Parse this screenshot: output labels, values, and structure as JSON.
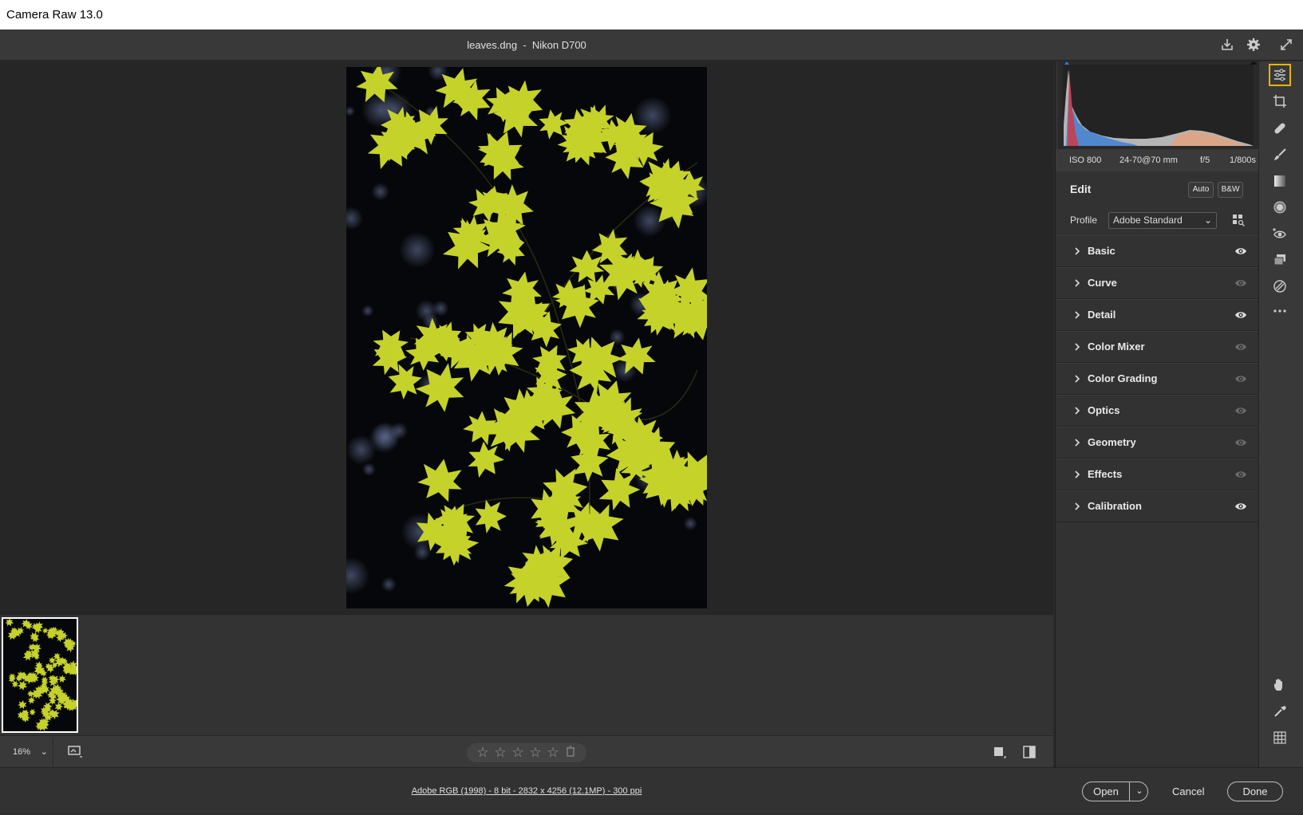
{
  "window": {
    "title": "Camera Raw 13.0"
  },
  "header": {
    "filename": "leaves.dng  -  Nikon D700",
    "icons": [
      "save-icon",
      "gear-icon",
      "fullscreen-icon"
    ]
  },
  "exif": {
    "iso": "ISO 800",
    "lens": "24-70@70 mm",
    "aperture": "f/5",
    "shutter": "1/800s"
  },
  "edit": {
    "title": "Edit",
    "auto_label": "Auto",
    "bw_label": "B&W",
    "profile_label": "Profile",
    "profile_value": "Adobe Standard"
  },
  "sections": [
    {
      "label": "Basic",
      "eye_visible": true
    },
    {
      "label": "Curve",
      "eye_visible": false
    },
    {
      "label": "Detail",
      "eye_visible": true
    },
    {
      "label": "Color Mixer",
      "eye_visible": false
    },
    {
      "label": "Color Grading",
      "eye_visible": false
    },
    {
      "label": "Optics",
      "eye_visible": false
    },
    {
      "label": "Geometry",
      "eye_visible": false
    },
    {
      "label": "Effects",
      "eye_visible": false
    },
    {
      "label": "Calibration",
      "eye_visible": true
    }
  ],
  "bottom": {
    "zoom": "16%",
    "star_count": 5,
    "stars_filled": 0
  },
  "footer": {
    "info": "Adobe RGB (1998) - 8 bit - 2832 x 4256 (12.1MP) - 300 ppi",
    "open_label": "Open",
    "cancel_label": "Cancel",
    "done_label": "Done"
  },
  "tools": [
    "edit-sliders-icon",
    "crop-icon",
    "healing-icon",
    "brush-icon",
    "linear-gradient-icon",
    "radial-filter-icon",
    "red-eye-icon",
    "snapshots-icon",
    "presets-icon",
    "more-icon"
  ],
  "colors": {
    "accent_active": "#e8b400",
    "leaf_yellow": "#c9d62a",
    "panel_bg": "#323232"
  }
}
